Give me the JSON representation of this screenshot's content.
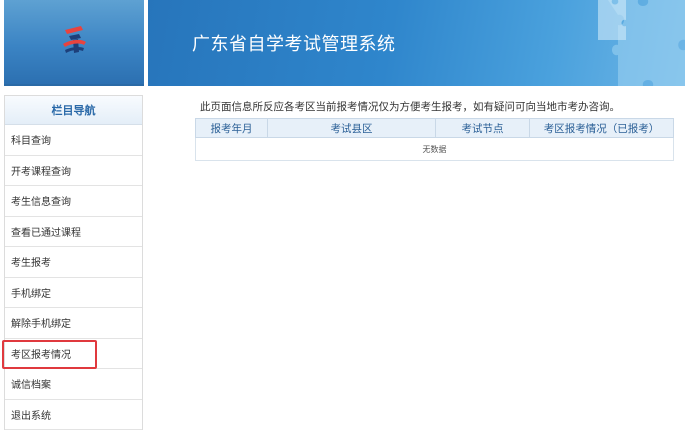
{
  "header": {
    "title": "广东省自学考试管理系统",
    "logo_icon": "exam-logo-icon",
    "decoration_icon": "puzzle-icon"
  },
  "sidebar": {
    "title": "栏目导航",
    "items": [
      {
        "label": "科目查询"
      },
      {
        "label": "开考课程查询"
      },
      {
        "label": "考生信息查询"
      },
      {
        "label": "查看已通过课程"
      },
      {
        "label": "考生报考"
      },
      {
        "label": "手机绑定"
      },
      {
        "label": "解除手机绑定"
      },
      {
        "label": "考区报考情况"
      },
      {
        "label": "诚信档案"
      },
      {
        "label": "退出系统"
      }
    ],
    "selected_index": 7
  },
  "main": {
    "notice": "此页面信息所反应各考区当前报考情况仅为方便考生报考，如有疑问可向当地市考办咨询。",
    "table": {
      "columns": [
        "报考年月",
        "考试县区",
        "考试节点",
        "考区报考情况（已报考）"
      ],
      "empty_text": "无数据"
    }
  },
  "colors": {
    "primary": "#2f86cc",
    "highlight": "#e0393e",
    "table_header_bg": "#e7f0f9"
  }
}
